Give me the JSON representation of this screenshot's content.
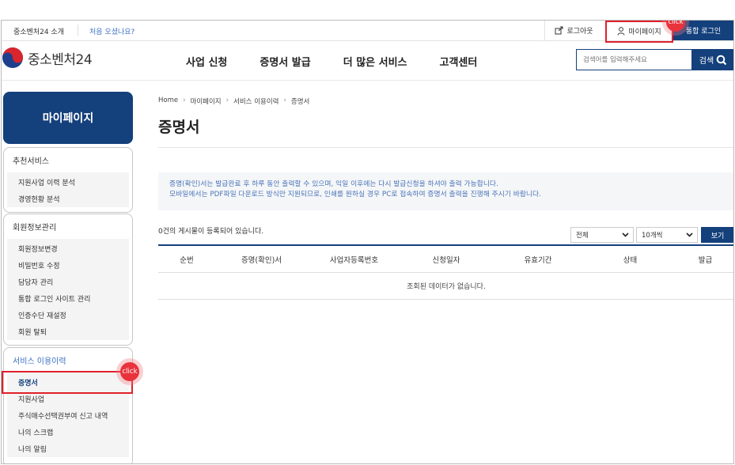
{
  "util_bar": {
    "intro": "중소벤처24 소개",
    "first_visit": "처음 오셨나요?",
    "logout": "로그아웃",
    "mypage": "마이페이지",
    "sso_login": "통합 로그인"
  },
  "header": {
    "logo_text": "중소벤처24",
    "nav": [
      "사업 신청",
      "증명서 발급",
      "더 많은 서비스",
      "고객센터"
    ],
    "search_placeholder": "검색어를 입력해주세요",
    "search_button": "검색"
  },
  "sidebar": {
    "title": "마이페이지",
    "groups": [
      {
        "title": "추천서비스",
        "items": [
          "지원사업 이력 분석",
          "경영현황 분석"
        ]
      },
      {
        "title": "회원정보관리",
        "items": [
          "회원정보변경",
          "비밀번호 수정",
          "담당자 관리",
          "통합 로그인 사이트 관리",
          "인증수단 재설정",
          "회원 탈퇴"
        ]
      },
      {
        "title": "서비스 이용이력",
        "items": [
          "증명서",
          "지원사업",
          "주식매수선택권부여 신고 내역",
          "나의 스크랩",
          "나의 알림"
        ]
      }
    ]
  },
  "breadcrumb": [
    "Home",
    "마이페이지",
    "서비스 이용이력",
    "증명서"
  ],
  "page_title": "증명서",
  "notice": {
    "line1": "증명(확인)서는 발급완료 후 하루 동안 출력할 수 있으며, 익일 이후에는 다시 발급신청을 하셔야 출력 가능합니다.",
    "line2": "모바일에서는 PDF파일 다운로드 방식만 지원되므로, 인쇄를 원하실 경우 PC로 접속하여 증명서 출력을 진행해 주시기 바랍니다."
  },
  "list": {
    "count_text": "0건의 게시물이 등록되어 있습니다.",
    "filter_value": "전체",
    "page_size_value": "10개씩",
    "view_button": "보기",
    "columns": [
      "순번",
      "증명(확인)서",
      "사업자등록번호",
      "신청일자",
      "유효기간",
      "상태",
      "발급"
    ],
    "empty_text": "조회된 데이터가 없습니다."
  },
  "annotations": {
    "click_label": "click"
  },
  "colors": {
    "brand_navy": "#14407c",
    "link_blue": "#3a6fc4",
    "highlight_red": "#e0202a"
  }
}
